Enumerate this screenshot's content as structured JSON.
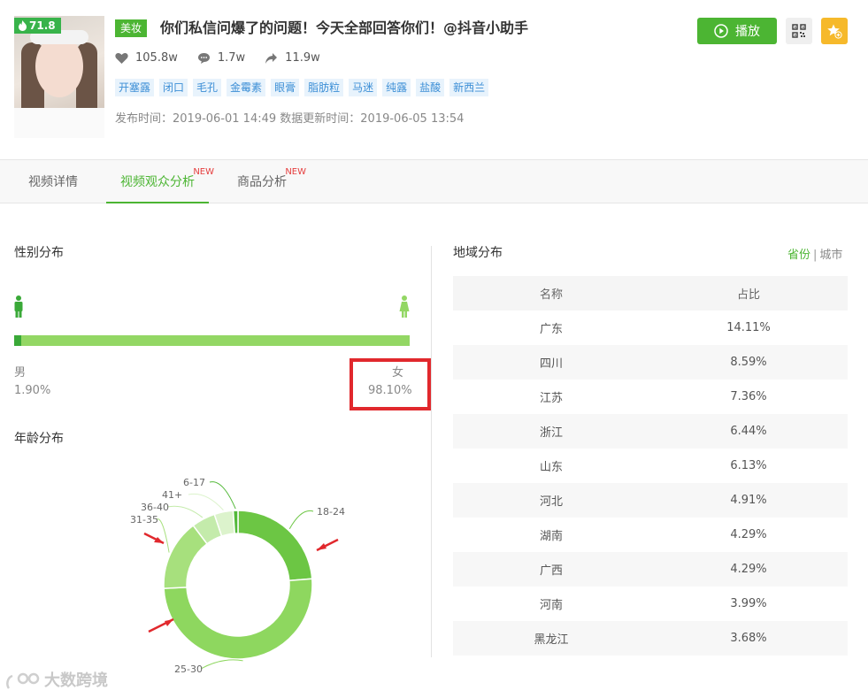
{
  "video": {
    "score": "71.8",
    "category": "美妆",
    "title": "你们私信问爆了的问题！今天全部回答你们！@抖音小助手",
    "likes": "105.8w",
    "comments": "1.7w",
    "shares": "11.9w",
    "tags": [
      "开塞露",
      "闭口",
      "毛孔",
      "金霉素",
      "眼膏",
      "脂肪粒",
      "马迷",
      "纯露",
      "盐酸",
      "新西兰"
    ],
    "dates": "发布时间：2019-06-01 14:49 数据更新时间：2019-06-05 13:54"
  },
  "actions": {
    "play_label": "播放"
  },
  "tabs": [
    {
      "label": "视频详情",
      "new": ""
    },
    {
      "label": "视频观众分析",
      "new": "NEW"
    },
    {
      "label": "商品分析",
      "new": "NEW"
    }
  ],
  "gender": {
    "title": "性别分布",
    "male_label": "男",
    "male_value": "1.90%",
    "male_fraction": 0.019,
    "female_label": "女",
    "female_value": "98.10%"
  },
  "age": {
    "title": "年龄分布"
  },
  "chart_data": {
    "type": "pie",
    "title": "",
    "categories": [
      "18-24",
      "25-30",
      "31-35",
      "36-40",
      "41+",
      "6-17"
    ],
    "values": [
      23,
      49,
      15,
      5,
      4,
      1
    ],
    "colors": [
      "#6cc644",
      "#8ed75f",
      "#a7e07d",
      "#c4ebab",
      "#dcf3cc",
      "#54b93a"
    ]
  },
  "region": {
    "title": "地域分布",
    "toggle_on": "省份",
    "toggle_sep": "|",
    "toggle_off": "城市",
    "headers": [
      "名称",
      "占比"
    ],
    "rows": [
      [
        "广东",
        "14.11%"
      ],
      [
        "四川",
        "8.59%"
      ],
      [
        "江苏",
        "7.36%"
      ],
      [
        "浙江",
        "6.44%"
      ],
      [
        "山东",
        "6.13%"
      ],
      [
        "河北",
        "4.91%"
      ],
      [
        "湖南",
        "4.29%"
      ],
      [
        "广西",
        "4.29%"
      ],
      [
        "河南",
        "3.99%"
      ],
      [
        "黑龙江",
        "3.68%"
      ]
    ]
  },
  "watermark": "大数跨境"
}
